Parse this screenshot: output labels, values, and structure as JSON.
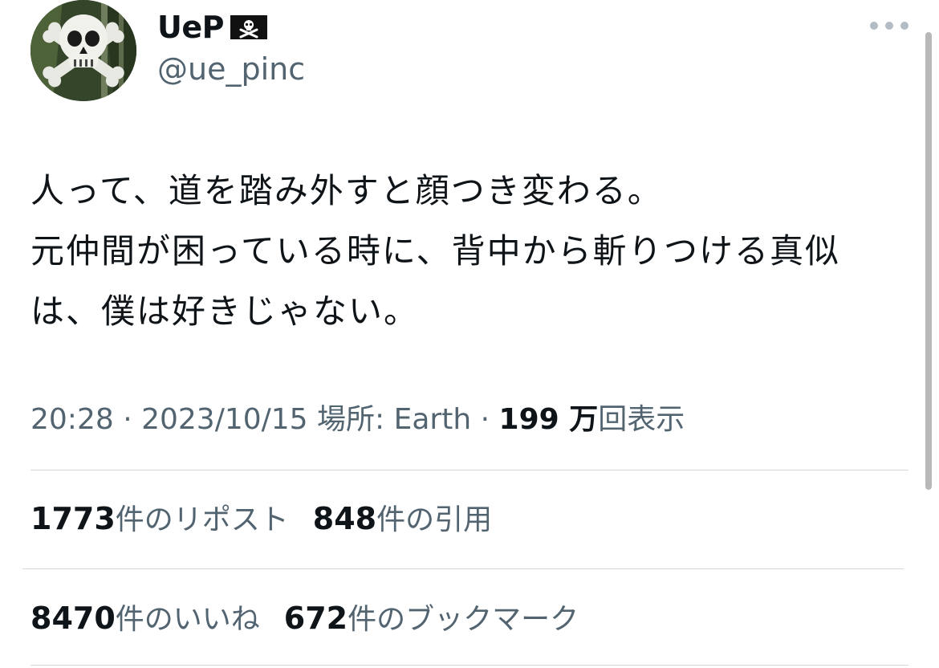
{
  "author": {
    "display_name": "UeP",
    "flag_emoji": "🏴‍☠️",
    "handle": "@ue_pinc"
  },
  "tweet": {
    "lines": [
      "人って、道を踏み外すと顔つき変わる。",
      "元仲間が困っている時に、背中から斬りつける真似",
      "は、僕は好きじゃない。"
    ]
  },
  "meta": {
    "time": "20:28",
    "sep1": " · ",
    "date": "2023/10/15",
    "location_label": " 場所: ",
    "location": "Earth",
    "sep2": " · ",
    "views_count": "199 万",
    "views_label": "回表示"
  },
  "stats": {
    "reposts_count": "1773",
    "reposts_label": "件のリポスト",
    "quotes_count": "848",
    "quotes_label": "件の引用",
    "likes_count": "8470",
    "likes_label": "件のいいね",
    "bookmarks_count": "672",
    "bookmarks_label": "件のブックマーク"
  },
  "icons": {
    "avatar": "skull-crossbones-avatar",
    "flag": "pirate-flag-icon",
    "more": "more-options-icon"
  },
  "colors": {
    "text": "#0f1419",
    "secondary": "#536471",
    "divider": "#d3d7da"
  }
}
